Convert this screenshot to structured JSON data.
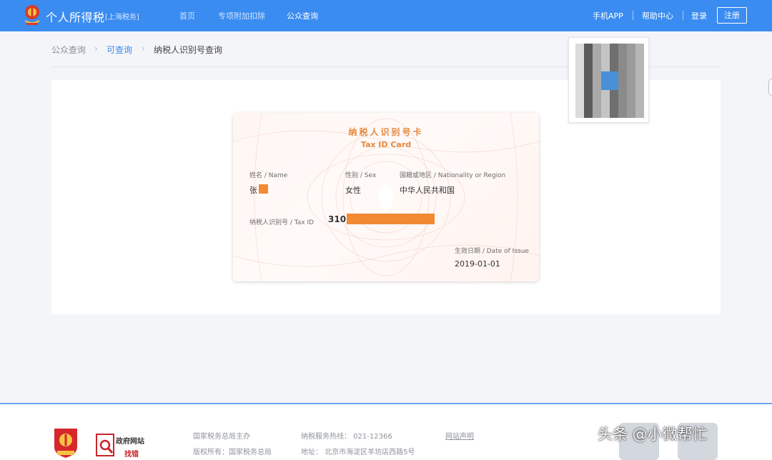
{
  "header": {
    "brand": "个人所得税",
    "brand_sub": "[上海税务]",
    "nav": [
      "首页",
      "专项附加扣除",
      "公众查询"
    ],
    "right": {
      "app": "手机APP",
      "help": "帮助中心",
      "login": "登录",
      "register": "注册"
    }
  },
  "breadcrumb": [
    "公众查询",
    "可查询",
    "纳税人识别号查询"
  ],
  "card": {
    "title_zh": "纳税人识别号卡",
    "title_en": "Tax ID Card",
    "name_label": "姓名 / Name",
    "name_value": "张",
    "sex_label": "性别 / Sex",
    "sex_value": "女性",
    "nationality_label": "国籍或地区 / Nationality or Region",
    "nationality_value": "中华人民共和国",
    "taxid_label": "纳税人识别号 / Tax ID",
    "taxid_value": "310",
    "date_label": "生效日期 / Date of Issue",
    "date_value": "2019-01-01"
  },
  "footer": {
    "sponsor": "国家税务总局主办",
    "copyright": "版权所有：国家税务总局",
    "hotline": "纳税服务热线：  021-12366",
    "address": "地址：  北京市海淀区羊坊店西路5号",
    "statement": "网站声明",
    "gov_site": "政府网站",
    "find_error": "找错"
  },
  "watermark": "头条 @小微帮忙",
  "colors": {
    "primary": "#3a8cf0",
    "accent": "#e6893f",
    "redact": "#f28a33"
  }
}
